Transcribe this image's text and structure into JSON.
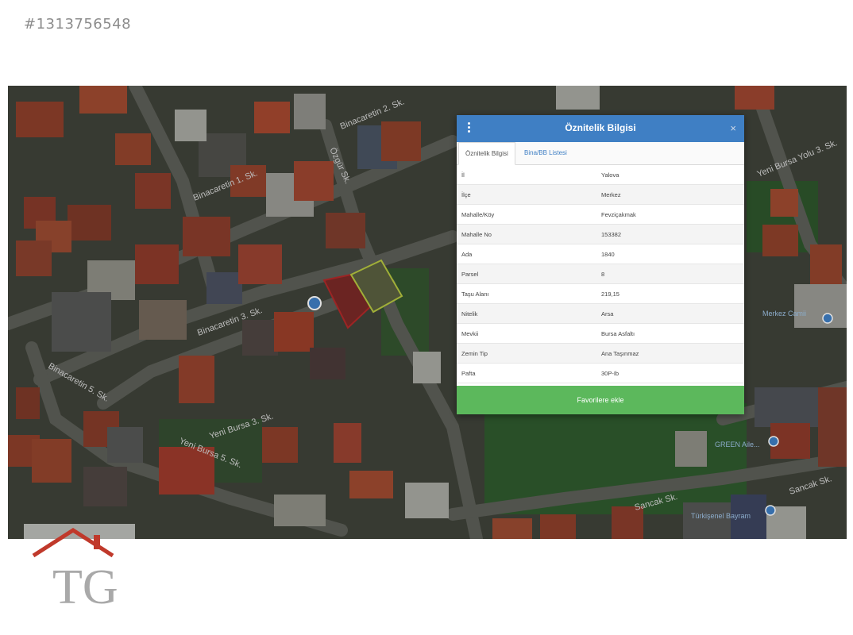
{
  "listing_id": "#1313756548",
  "map": {
    "streets": [
      {
        "label": "Binacaretin 2. Sk."
      },
      {
        "label": "Binacaretin 1. Sk."
      },
      {
        "label": "Binacaretin 3. Sk."
      },
      {
        "label": "Binacaretin 5. Sk."
      },
      {
        "label": "Yeni Bursa 3. Sk."
      },
      {
        "label": "Yeni Bursa 5. Sk."
      },
      {
        "label": "Yeni Bursa Yolu 3. Sk."
      },
      {
        "label": "Sancak Sk."
      },
      {
        "label": "Özgür Sk."
      },
      {
        "label": "Sancak Sk."
      }
    ],
    "pois": [
      "GREEN Aile...",
      "Merkez Camii",
      "Türkişenel Bayram"
    ]
  },
  "popup": {
    "title": "Öznitelik Bilgisi",
    "tabs": [
      {
        "label": "Öznitelik Bilgisi",
        "active": true
      },
      {
        "label": "Bina/BB Listesi",
        "active": false
      }
    ],
    "rows": [
      {
        "key": "İl",
        "value": "Yalova"
      },
      {
        "key": "İlçe",
        "value": "Merkez"
      },
      {
        "key": "Mahalle/Köy",
        "value": "Fevziçakmak"
      },
      {
        "key": "Mahalle No",
        "value": "153382"
      },
      {
        "key": "Ada",
        "value": "1840"
      },
      {
        "key": "Parsel",
        "value": "8"
      },
      {
        "key": "Taşu Alanı",
        "value": "219,15"
      },
      {
        "key": "Nitelik",
        "value": "Arsa"
      },
      {
        "key": "Mevkii",
        "value": "Bursa Asfaltı"
      },
      {
        "key": "Zemin Tip",
        "value": "Ana Taşınmaz"
      },
      {
        "key": "Pafta",
        "value": "30P-Ib"
      }
    ],
    "favorite_button": "Favorilere ekle",
    "close_glyph": "×"
  },
  "logo": {
    "text": "TG",
    "color": "#c0392b"
  },
  "colors": {
    "header": "#3f7fc4",
    "button": "#5cb85c",
    "parcel_outline": "#b8c840",
    "parcel_adjacent": "#b22a2a"
  }
}
